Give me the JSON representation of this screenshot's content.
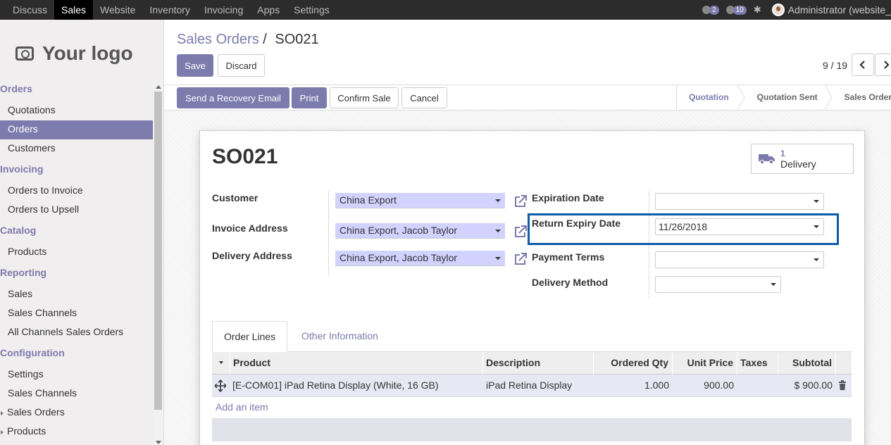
{
  "topbar": {
    "menu": [
      "Discuss",
      "Sales",
      "Website",
      "Inventory",
      "Invoicing",
      "Apps",
      "Settings"
    ],
    "active_menu": "Sales",
    "chat_count": "2",
    "activity_count": "10",
    "user": "Administrator (website_"
  },
  "sidebar": {
    "logo_text": "Your logo",
    "sections": [
      {
        "title": "Orders",
        "items": [
          "Quotations",
          "Orders",
          "Customers"
        ]
      },
      {
        "title": "Invoicing",
        "items": [
          "Orders to Invoice",
          "Orders to Upsell"
        ]
      },
      {
        "title": "Catalog",
        "items": [
          "Products"
        ]
      },
      {
        "title": "Reporting",
        "items": [
          "Sales",
          "Sales Channels",
          "All Channels Sales Orders"
        ]
      },
      {
        "title": "Configuration",
        "items": [
          "Settings",
          "Sales Channels",
          "Sales Orders",
          "Products"
        ]
      }
    ],
    "active_item": "Orders"
  },
  "control": {
    "breadcrumb_parent": "Sales Orders",
    "breadcrumb_sep": "/",
    "breadcrumb_current": "SO021",
    "save_label": "Save",
    "discard_label": "Discard",
    "pager": "9 / 19",
    "prev_icon": "chevron-left",
    "next_icon": "chevron-right"
  },
  "statusbar": {
    "buttons": {
      "recovery": "Send a Recovery Email",
      "print": "Print",
      "confirm": "Confirm Sale",
      "cancel": "Cancel"
    },
    "stages": [
      "Quotation",
      "Quotation Sent",
      "Sales Order"
    ],
    "current_stage": "Quotation"
  },
  "form": {
    "name": "SO021",
    "delivery_count": "1",
    "delivery_label": "Delivery",
    "left_fields": {
      "customer_label": "Customer",
      "customer_value": "China Export",
      "invoice_label": "Invoice Address",
      "invoice_value": "China Export, Jacob Taylor",
      "delivery_label": "Delivery Address",
      "delivery_value": "China Export, Jacob Taylor"
    },
    "right_fields": {
      "expiration_label": "Expiration Date",
      "expiration_value": "",
      "return_expiry_label": "Return Expiry Date",
      "return_expiry_value": "11/26/2018",
      "payment_terms_label": "Payment Terms",
      "payment_terms_value": "",
      "delivery_method_label": "Delivery Method",
      "delivery_method_value": ""
    },
    "tabs": [
      "Order Lines",
      "Other Information"
    ],
    "active_tab": "Order Lines",
    "order_lines": {
      "columns": [
        "Product",
        "Description",
        "Ordered Qty",
        "Unit Price",
        "Taxes",
        "Subtotal"
      ],
      "rows": [
        {
          "product": "[E-COM01] iPad Retina Display (White, 16 GB)",
          "description": "iPad Retina Display",
          "qty": "1.000",
          "unit_price": "900.00",
          "taxes": "",
          "subtotal": "$ 900.00"
        }
      ],
      "add_item": "Add an item"
    }
  },
  "colors": {
    "accent": "#7c7bad",
    "highlight": "#0d5cab",
    "navbar": "#2c2c2c"
  }
}
